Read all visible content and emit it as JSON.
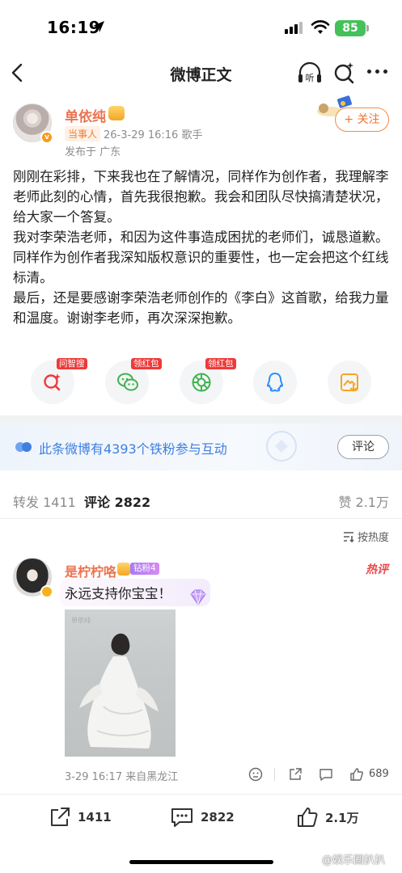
{
  "status_bar": {
    "time": "16:19",
    "battery": "85"
  },
  "nav": {
    "title": "微博正文",
    "listen_label": "听"
  },
  "post": {
    "author": "单依纯",
    "party_tag": "当事人",
    "meta": "26-3-29 16:16  歌手",
    "location": "发布于 广东",
    "follow_label": "+ 关注",
    "paragraphs": [
      "刚刚在彩排，下来我也在了解情况，同样作为创作者，我理解李老师此刻的心情，首先我很抱歉。我会和团队尽快搞清楚状况，给大家一个答复。",
      "我对李荣浩老师，和因为这件事造成困扰的老师们，诚恳道歉。同样作为创作者我深知版权意识的重要性，也一定会把这个红线标清。",
      "最后，还是要感谢李荣浩老师创作的《李白》这首歌，给我力量和温度。谢谢李老师，再次深深抱歉。"
    ]
  },
  "actions": [
    {
      "icon": "ai-search-icon",
      "tag": "问智搜"
    },
    {
      "icon": "wechat-icon",
      "tag": "领红包"
    },
    {
      "icon": "moments-icon",
      "tag": "领红包"
    },
    {
      "icon": "qq-icon",
      "tag": ""
    },
    {
      "icon": "save-image-icon",
      "tag": ""
    }
  ],
  "fans_banner": {
    "text": "此条微博有4393个铁粉参与互动",
    "button": "评论"
  },
  "tabs": {
    "repost": "转发 1411",
    "comment": "评论 2822",
    "like": "赞 2.1万"
  },
  "sort_label": "按热度",
  "comment": {
    "author": "是柠柠咯",
    "fan_tag": "钻粉4",
    "hot_tag": "热评",
    "text": "永远支持你宝宝！",
    "image_watermark": "单依纯",
    "meta": "3-29 16:17  来自黑龙江",
    "likes": "689"
  },
  "bottom_bar": {
    "repost": "1411",
    "comment": "2822",
    "like": "2.1万"
  },
  "watermark": "@娱乐圈扒扒",
  "colors": {
    "accent": "#eb7350",
    "link_blue": "#3e7fe0",
    "red_tag": "#ee3a3a"
  }
}
